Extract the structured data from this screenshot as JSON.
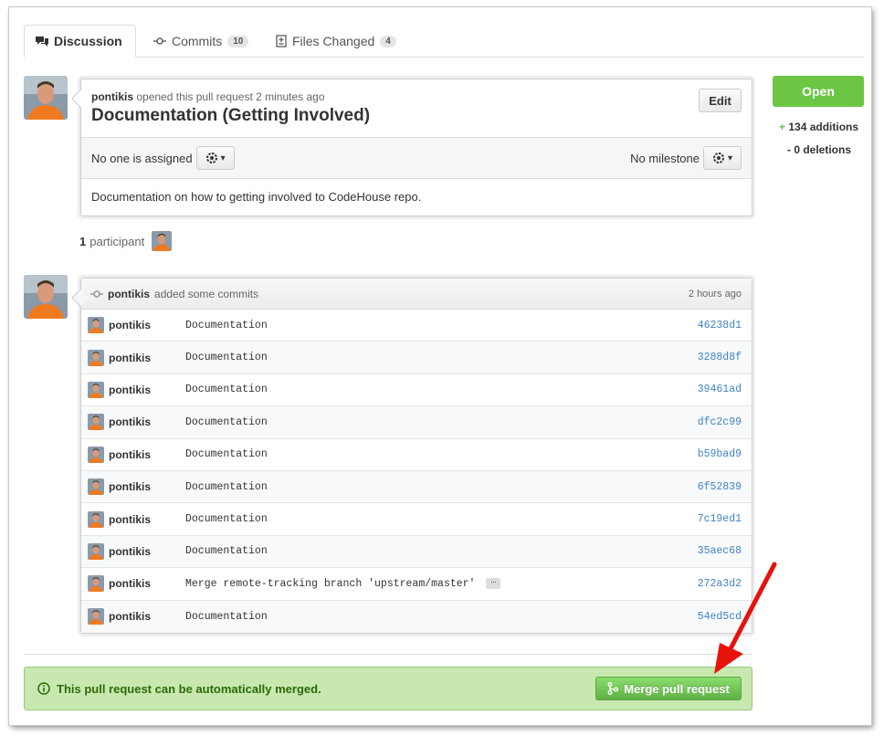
{
  "tabs": [
    {
      "label": "Discussion",
      "icon": "discussion-icon"
    },
    {
      "label": "Commits",
      "count": "10",
      "icon": "commit-icon"
    },
    {
      "label": "Files Changed",
      "count": "4",
      "icon": "file-diff-icon"
    }
  ],
  "pull_request": {
    "author": "pontikis",
    "opened_text": "opened this pull request 2 minutes ago",
    "title": "Documentation (Getting Involved)",
    "edit_label": "Edit",
    "assignee_text": "No one is assigned",
    "milestone_text": "No milestone",
    "description": "Documentation on how to getting involved to CodeHouse repo."
  },
  "participants": {
    "count": "1",
    "label": "participant"
  },
  "sidebar": {
    "state": "Open",
    "additions_sign": "+",
    "additions": "134 additions",
    "deletions": "- 0 deletions"
  },
  "commits_block": {
    "author": "pontikis",
    "action": "added some commits",
    "time": "2 hours ago",
    "commits": [
      {
        "author": "pontikis",
        "message": "Documentation",
        "sha": "46238d1"
      },
      {
        "author": "pontikis",
        "message": "Documentation",
        "sha": "3288d8f"
      },
      {
        "author": "pontikis",
        "message": "Documentation",
        "sha": "39461ad"
      },
      {
        "author": "pontikis",
        "message": "Documentation",
        "sha": "dfc2c99"
      },
      {
        "author": "pontikis",
        "message": "Documentation",
        "sha": "b59bad9"
      },
      {
        "author": "pontikis",
        "message": "Documentation",
        "sha": "6f52839"
      },
      {
        "author": "pontikis",
        "message": "Documentation",
        "sha": "7c19ed1"
      },
      {
        "author": "pontikis",
        "message": "Documentation",
        "sha": "35aec68"
      },
      {
        "author": "pontikis",
        "message": "Merge remote-tracking branch 'upstream/master'",
        "sha": "272a3d2",
        "expand": "…"
      },
      {
        "author": "pontikis",
        "message": "Documentation",
        "sha": "54ed5cd"
      }
    ]
  },
  "merge": {
    "message": "This pull request can be automatically merged.",
    "button_label": "Merge pull request"
  },
  "colors": {
    "green": "#6cc644",
    "link": "#4183c4",
    "annotation_arrow": "#e8120c"
  }
}
